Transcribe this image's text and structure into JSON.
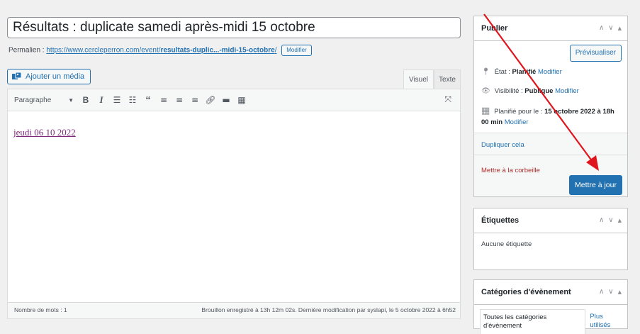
{
  "editor": {
    "title": "Résultats : duplicate samedi après-midi 15 octobre",
    "permalink_label": "Permalien :",
    "permalink_base": "https://www.cercleperron.com/event/",
    "permalink_slug": "resultats-duplic...-midi-15-octobre",
    "permalink_trail": "/",
    "permalink_edit": "Modifier",
    "add_media": "Ajouter un média",
    "tab_visual": "Visuel",
    "tab_text": "Texte",
    "format_select": "Paragraphe",
    "content_text": "jeudi 06 10 2022",
    "word_count": "Nombre de mots : 1",
    "save_status": "Brouillon enregistré à 13h 12m 02s. Dernière modification par syslapi, le 5 octobre 2022 à 6h52"
  },
  "toolbar_icons": [
    "bold-icon",
    "italic-icon",
    "bullet-list-icon",
    "numbered-list-icon",
    "blockquote-icon",
    "align-left-icon",
    "align-center-icon",
    "align-right-icon",
    "link-icon",
    "read-more-icon",
    "toolbar-toggle-icon",
    "fullscreen-icon"
  ],
  "publish": {
    "heading": "Publier",
    "preview": "Prévisualiser",
    "status_label": "État :",
    "status_value": "Planifié",
    "status_edit": "Modifier",
    "visibility_label": "Visibilité :",
    "visibility_value": "Publique",
    "visibility_edit": "Modifier",
    "schedule_label": "Planifié pour le :",
    "schedule_value_1": "15 octobre 2022 à 18h",
    "schedule_value_2": "00 min",
    "schedule_edit": "Modifier",
    "duplicate": "Dupliquer cela",
    "trash": "Mettre à la corbeille",
    "update": "Mettre à jour"
  },
  "tags": {
    "heading": "Étiquettes",
    "empty": "Aucune étiquette"
  },
  "categories": {
    "heading": "Catégories d'évènement",
    "tab_all": "Toutes les catégories d'évènement",
    "tab_popular": "Plus utilisés"
  },
  "colors": {
    "accent": "#2271b1",
    "annotation_arrow": "#e0161e",
    "trash": "#b32d2e"
  }
}
